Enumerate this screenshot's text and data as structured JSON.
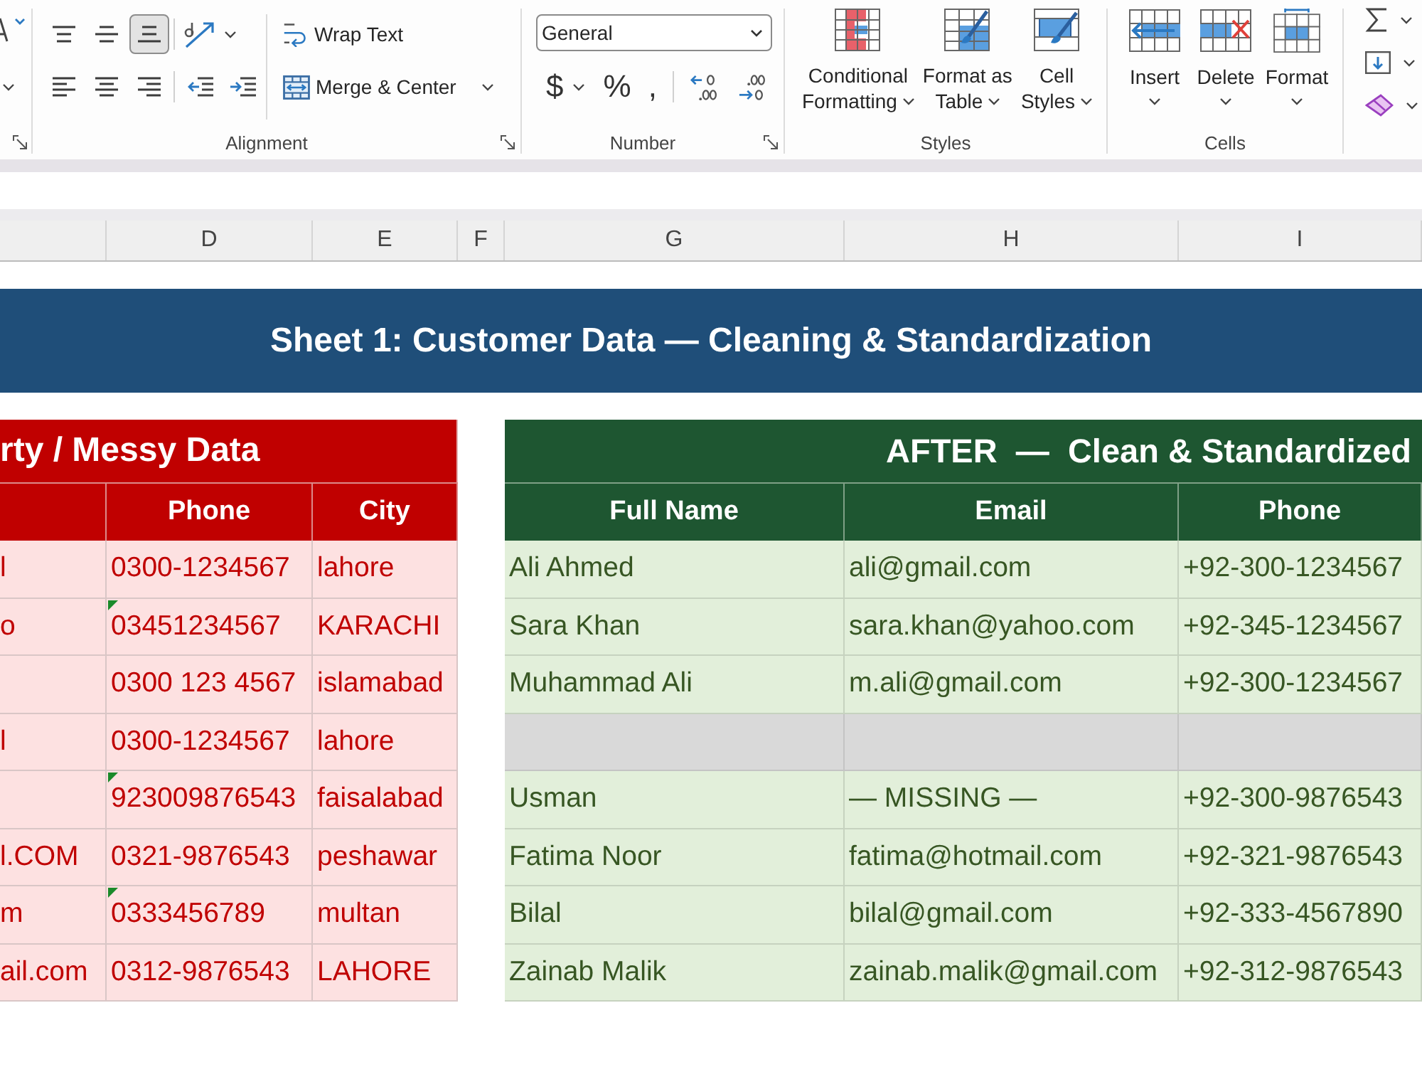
{
  "ribbon": {
    "alignment": {
      "label": "Alignment",
      "vertical": [
        {
          "kind": "top",
          "selected": false
        },
        {
          "kind": "middle",
          "selected": false
        },
        {
          "kind": "bottom",
          "selected": true
        }
      ],
      "horizontal": [
        {
          "kind": "left",
          "selected": false
        },
        {
          "kind": "center",
          "selected": false
        },
        {
          "kind": "right",
          "selected": false
        }
      ],
      "wrap_text": "Wrap Text",
      "merge": "Merge & Center"
    },
    "number": {
      "label": "Number",
      "format": "General",
      "symbols": [
        {
          "label": "$",
          "dropdown": true
        },
        {
          "label": "%",
          "dropdown": false
        },
        {
          "label": ",",
          "dropdown": false
        }
      ]
    },
    "styles": {
      "label": "Styles",
      "buttons": [
        {
          "kind": "conditional",
          "lines": [
            "Conditional",
            "Formatting"
          ]
        },
        {
          "kind": "table",
          "lines": [
            "Format as",
            "Table"
          ]
        },
        {
          "kind": "cell",
          "lines": [
            "Cell",
            "Styles"
          ]
        }
      ]
    },
    "cells": {
      "label": "Cells",
      "buttons": [
        {
          "kind": "insert",
          "label": "Insert"
        },
        {
          "kind": "delete",
          "label": "Delete"
        },
        {
          "kind": "format",
          "label": "Format"
        }
      ]
    }
  },
  "column_headers": [
    "D",
    "E",
    "F",
    "G",
    "H",
    "I"
  ],
  "sheet_title": "Sheet 1: Customer Data — Cleaning & Standardization",
  "before": {
    "title": "rty / Messy Data",
    "columns": [
      "Phone",
      "City"
    ],
    "rows": [
      {
        "column_1": "l",
        "phone": "0300-1234567",
        "city": "lahore",
        "flagged": false
      },
      {
        "column_1": "o",
        "phone": "03451234567",
        "city": "KARACHI",
        "flagged": true
      },
      {
        "phone": "0300 123 4567",
        "city": "islamabad",
        "flagged": false
      },
      {
        "column_1": "l",
        "phone": "0300-1234567",
        "city": "lahore",
        "flagged": false
      },
      {
        "phone": "923009876543",
        "city": "faisalabad",
        "flagged": true
      },
      {
        "column_1": "l.COM",
        "phone": "0321-9876543",
        "city": "peshawar",
        "flagged": false
      },
      {
        "column_1": "m",
        "phone": "0333456789",
        "city": "multan",
        "flagged": true
      },
      {
        "column_1": "ail.com",
        "phone": "0312-9876543",
        "city": "LAHORE",
        "flagged": false
      }
    ]
  },
  "after": {
    "title": "AFTER  —  Clean & Standardized",
    "columns": [
      "Full Name",
      "Email",
      "Phone"
    ],
    "rows": [
      {
        "removed": false,
        "full_name": "Ali Ahmed",
        "email": "ali@gmail.com",
        "phone": "+92-300-1234567"
      },
      {
        "removed": false,
        "full_name": "Sara Khan",
        "email": "sara.khan@yahoo.com",
        "phone": "+92-345-1234567"
      },
      {
        "removed": false,
        "full_name": "Muhammad Ali",
        "email": "m.ali@gmail.com",
        "phone": "+92-300-1234567"
      },
      {
        "removed": true
      },
      {
        "removed": false,
        "full_name": "Usman",
        "email": "— MISSING —",
        "phone": "+92-300-9876543"
      },
      {
        "removed": false,
        "full_name": "Fatima Noor",
        "email": "fatima@hotmail.com",
        "phone": "+92-321-9876543"
      },
      {
        "removed": false,
        "full_name": "Bilal",
        "email": "bilal@gmail.com",
        "phone": "+92-333-4567890"
      },
      {
        "removed": false,
        "full_name": "Zainab Malik",
        "email": "zainab.malik@gmail.com",
        "phone": "+92-312-9876543"
      }
    ]
  }
}
